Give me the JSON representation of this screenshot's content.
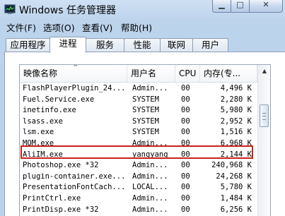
{
  "window": {
    "title": "Windows 任务管理器",
    "app_icon": "task-manager-icon",
    "controls": {
      "minimize": "▁",
      "maximize": "□",
      "close": "✕"
    }
  },
  "menu": [
    "文件(F)",
    "选项(O)",
    "查看(V)",
    "帮助(H)"
  ],
  "tabs": [
    "应用程序",
    "进程",
    "服务",
    "性能",
    "联网",
    "用户"
  ],
  "active_tab": "进程",
  "columns": {
    "name": "映像名称",
    "sort_indicator": "^",
    "user": "用户名",
    "cpu": "CPU",
    "memory": "内存(专..."
  },
  "processes": [
    {
      "name": "FlashPlayerPlugin_24...",
      "user": "Admin...",
      "cpu": "00",
      "memory": "4,496 K"
    },
    {
      "name": "Fuel.Service.exe",
      "user": "SYSTEM",
      "cpu": "00",
      "memory": "2,280 K"
    },
    {
      "name": "inetinfo.exe",
      "user": "SYSTEM",
      "cpu": "00",
      "memory": "5,980 K"
    },
    {
      "name": "lsass.exe",
      "user": "SYSTEM",
      "cpu": "00",
      "memory": "2,952 K"
    },
    {
      "name": "lsm.exe",
      "user": "SYSTEM",
      "cpu": "00",
      "memory": "1,516 K"
    },
    {
      "name": "MOM.exe",
      "user": "Admin...",
      "cpu": "00",
      "memory": "6,968 K"
    },
    {
      "name": "AliIM.exe",
      "user": "yangyang",
      "cpu": "00",
      "memory": "2,144 K"
    },
    {
      "name": "Photoshop.exe *32",
      "user": "Admin...",
      "cpu": "00",
      "memory": "240,968 K"
    },
    {
      "name": "plugin-container.exe...",
      "user": "Admin...",
      "cpu": "00",
      "memory": "24,268 K"
    },
    {
      "name": "PresentationFontCach...",
      "user": "LOCAL...",
      "cpu": "00",
      "memory": "5,780 K"
    },
    {
      "name": "PrintCtrl.exe",
      "user": "Admin...",
      "cpu": "00",
      "memory": "1,484 K"
    },
    {
      "name": "PrintDisp.exe *32",
      "user": "Admin...",
      "cpu": "00",
      "memory": "6,256 K"
    }
  ],
  "highlighted_process": "AliIM.exe",
  "highlight_color": "#c8221b",
  "scrollbar": {
    "up_icon": "▲",
    "down_icon": "▼"
  }
}
